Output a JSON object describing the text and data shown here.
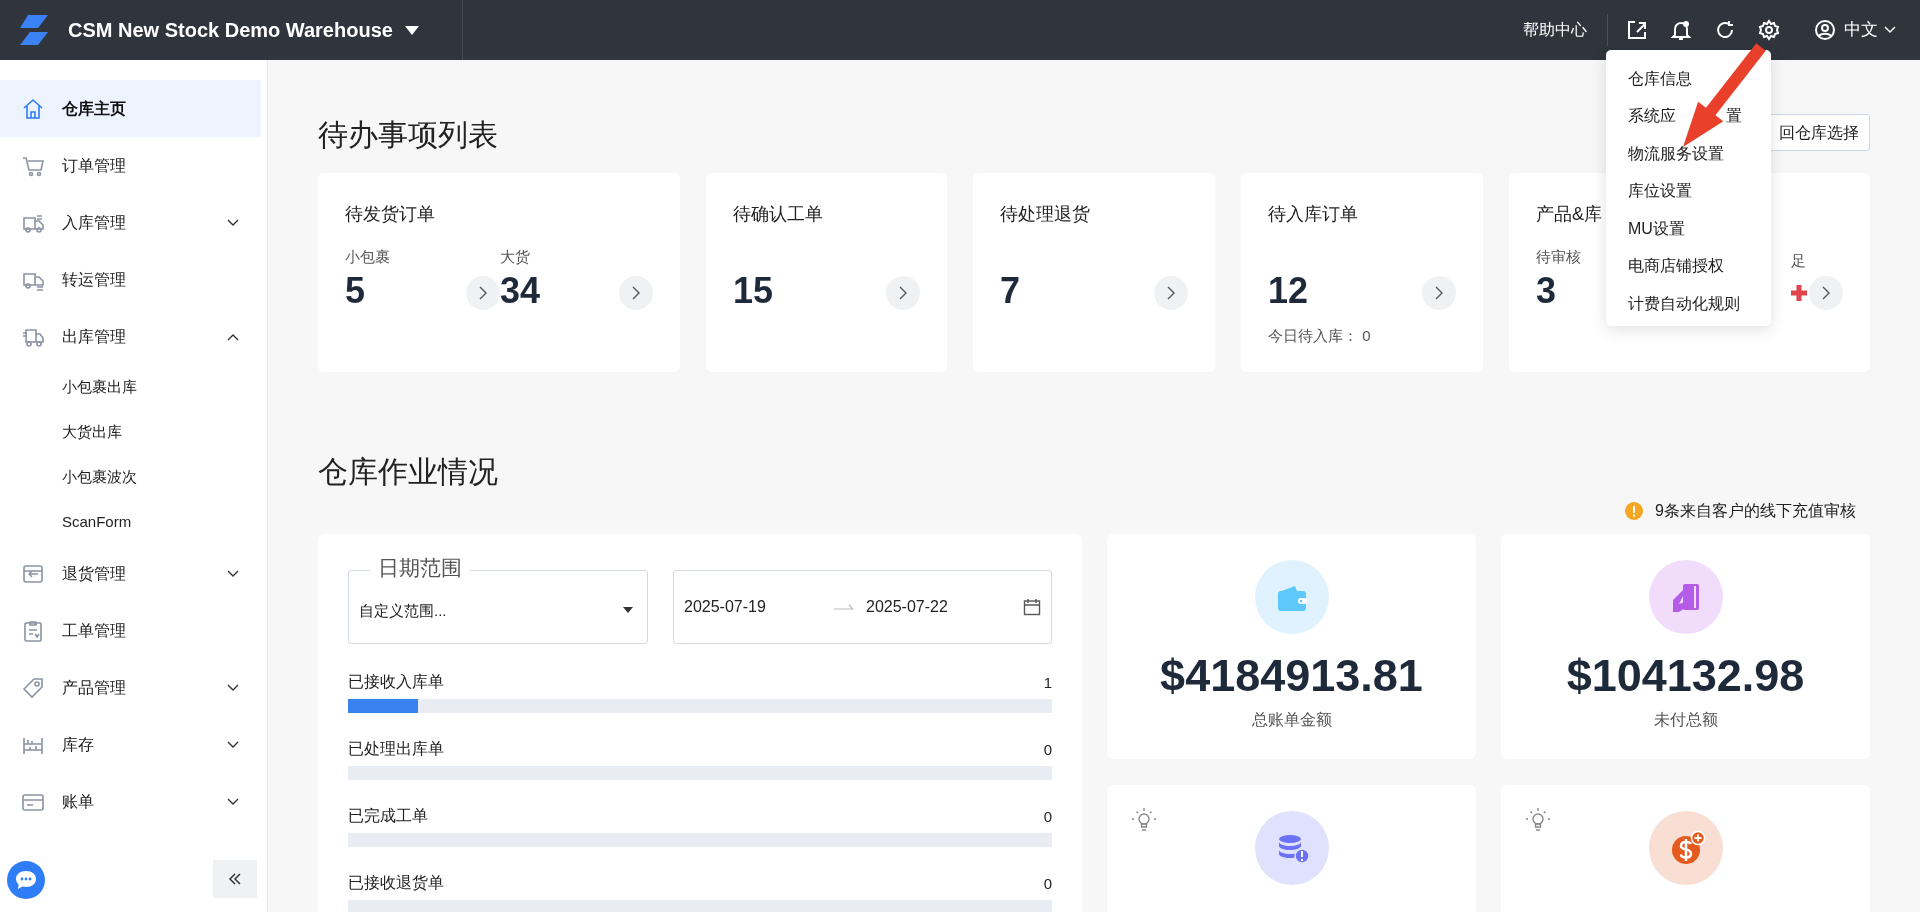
{
  "app": {
    "title": "CSM New Stock Demo Warehouse"
  },
  "header": {
    "help": "帮助中心",
    "language": "中文"
  },
  "settings_menu": {
    "items": [
      {
        "label": "仓库信息"
      },
      {
        "label": "系统应",
        "tail": "置"
      },
      {
        "label": "物流服务设置"
      },
      {
        "label": "库位设置"
      },
      {
        "label": "MU设置"
      },
      {
        "label": "电商店铺授权"
      },
      {
        "label": "计费自动化规则"
      }
    ]
  },
  "sidebar": {
    "items": [
      {
        "label": "仓库主页",
        "kind": "link",
        "selected": true
      },
      {
        "label": "订单管理",
        "kind": "link",
        "selected": false
      },
      {
        "label": "入库管理",
        "kind": "group",
        "selected": false,
        "expanded": false
      },
      {
        "label": "转运管理",
        "kind": "link",
        "selected": false
      },
      {
        "label": "出库管理",
        "kind": "group",
        "selected": false,
        "expanded": true,
        "children": [
          {
            "label": "小包裹出库",
            "selected": false
          },
          {
            "label": "大货出库",
            "selected": false
          },
          {
            "label": "小包裹波次",
            "selected": false
          },
          {
            "label": "ScanForm",
            "selected": false
          }
        ]
      },
      {
        "label": "退货管理",
        "kind": "group",
        "selected": false,
        "expanded": false
      },
      {
        "label": "工单管理",
        "kind": "link",
        "selected": false
      },
      {
        "label": "产品管理",
        "kind": "group",
        "selected": false,
        "expanded": false
      },
      {
        "label": "库存",
        "kind": "group",
        "selected": false,
        "expanded": false
      },
      {
        "label": "账单",
        "kind": "group",
        "selected": false,
        "expanded": false
      }
    ]
  },
  "todo": {
    "title": "待办事项列表",
    "back_button": "回仓库选择",
    "cards": [
      {
        "title": "待发货订单",
        "metrics": [
          {
            "label": "小包裹",
            "value": "5"
          },
          {
            "label": "大货",
            "value": "34"
          }
        ]
      },
      {
        "title": "待确认工单",
        "metrics": [
          {
            "value": "15"
          }
        ]
      },
      {
        "title": "待处理退货",
        "metrics": [
          {
            "value": "7"
          }
        ]
      },
      {
        "title": "待入库订单",
        "metrics": [
          {
            "value": "12"
          }
        ],
        "note": "今日待入库： 0"
      },
      {
        "title": "产品&库",
        "metrics": [
          {
            "label": "待审核",
            "value": "3"
          },
          {
            "label": "足"
          }
        ]
      }
    ]
  },
  "operations": {
    "title": "仓库作业情况",
    "notice": "9条来自客户的线下充值审核",
    "date_range": {
      "legend": "日期范围",
      "value": "自定义范围...",
      "start": "2025-07-19",
      "end": "2025-07-22"
    },
    "rows": [
      {
        "label": "已接收入库单",
        "count": "1",
        "level": 0.1
      },
      {
        "label": "已处理出库单",
        "count": "0",
        "level": 0
      },
      {
        "label": "已完成工单",
        "count": "0",
        "level": 0
      },
      {
        "label": "已接收退货单",
        "count": "0",
        "level": 0
      }
    ],
    "stats": [
      {
        "value": "$4184913.81",
        "label": "总账单金额",
        "hint": false
      },
      {
        "value": "$104132.98",
        "label": "未付总额",
        "hint": false
      },
      {
        "hint": true
      },
      {
        "hint": true
      }
    ]
  }
}
